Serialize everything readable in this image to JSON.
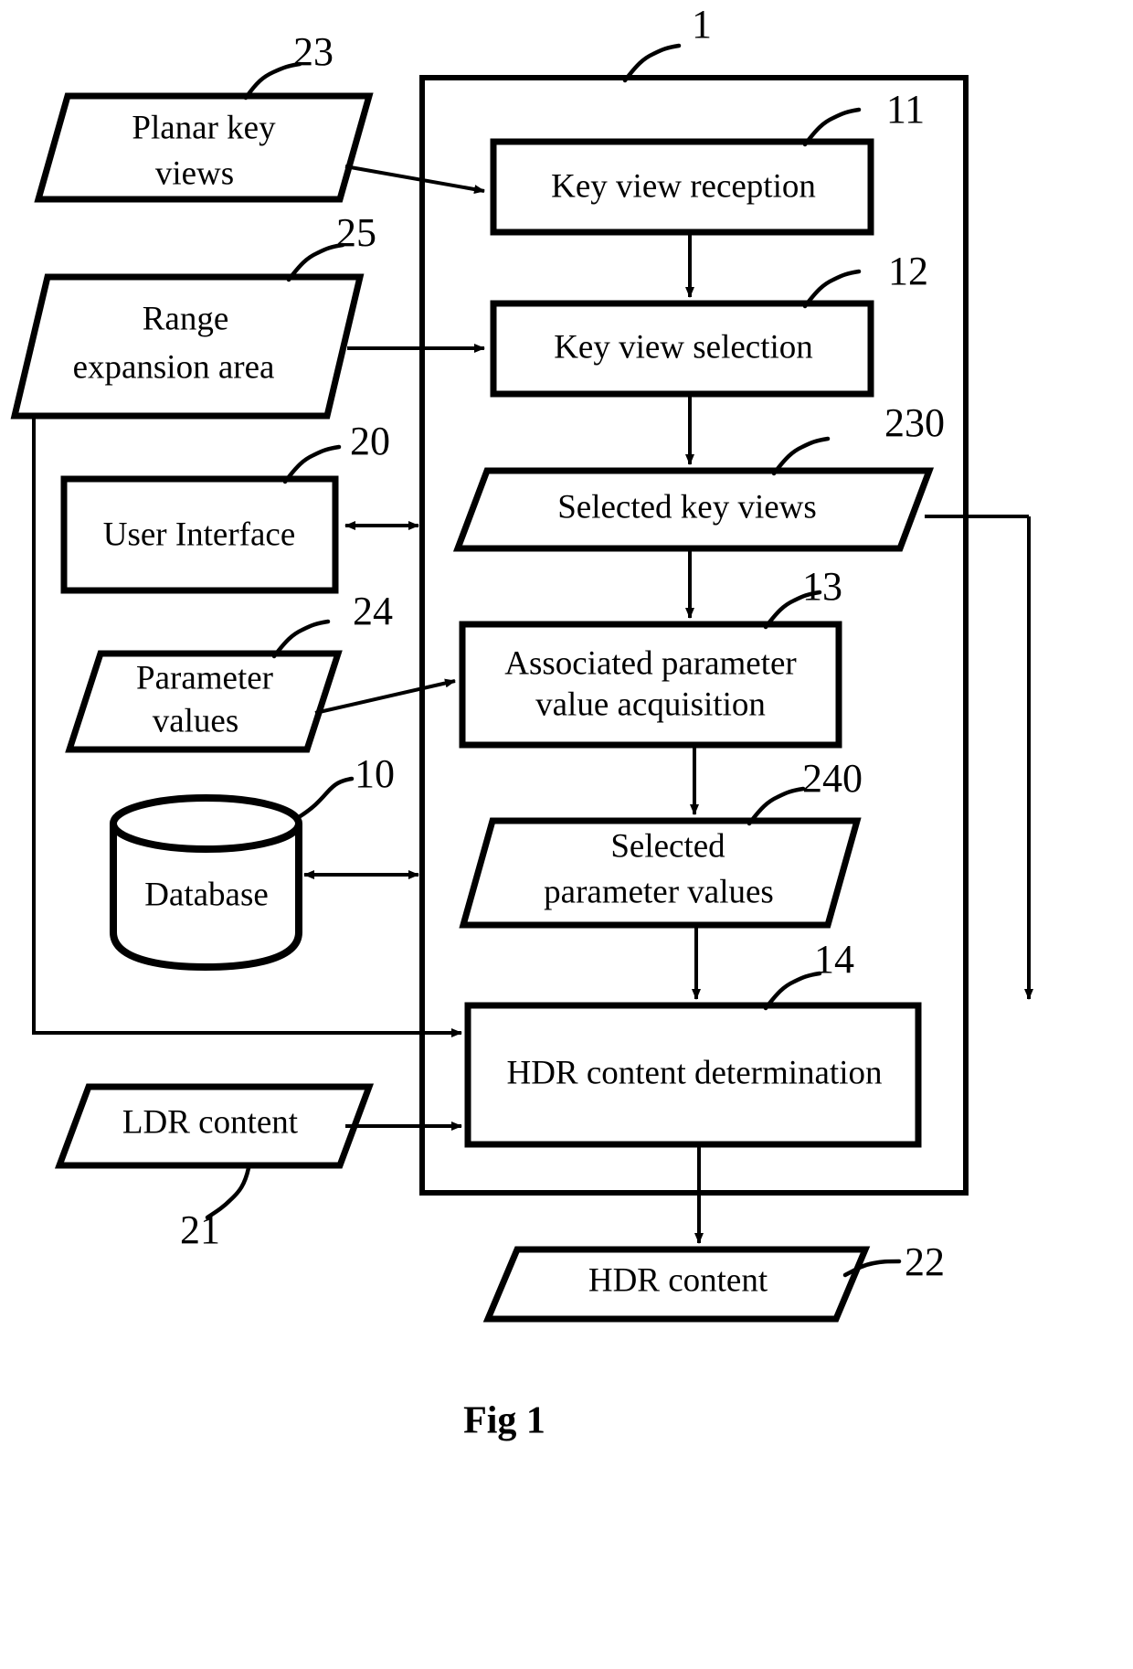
{
  "figure": {
    "caption": "Fig 1",
    "system_ref": "1"
  },
  "nodes": {
    "planar_key_views": {
      "label_line1": "Planar key",
      "label_line2": "views",
      "ref": "23",
      "shape": "parallelogram"
    },
    "range_expansion_area": {
      "label_line1": "Range",
      "label_line2": "expansion area",
      "ref": "25",
      "shape": "parallelogram"
    },
    "user_interface": {
      "label": "User Interface",
      "ref": "20",
      "shape": "rectangle"
    },
    "parameter_values": {
      "label_line1": "Parameter",
      "label_line2": "values",
      "ref": "24",
      "shape": "parallelogram"
    },
    "database": {
      "label": "Database",
      "ref": "10",
      "shape": "cylinder"
    },
    "ldr_content": {
      "label": "LDR content",
      "ref": "21",
      "shape": "parallelogram"
    },
    "key_view_reception": {
      "label": "Key view reception",
      "ref": "11",
      "shape": "rectangle"
    },
    "key_view_selection": {
      "label": "Key view selection",
      "ref": "12",
      "shape": "rectangle"
    },
    "selected_key_views": {
      "label": "Selected key views",
      "ref": "230",
      "shape": "parallelogram"
    },
    "associated_parameter_value_acquisition": {
      "label_line1": "Associated parameter",
      "label_line2": "value acquisition",
      "ref": "13",
      "shape": "rectangle"
    },
    "selected_parameter_values": {
      "label_line1": "Selected",
      "label_line2": "parameter values",
      "ref": "240",
      "shape": "parallelogram"
    },
    "hdr_content_determination": {
      "label": "HDR content determination",
      "ref": "14",
      "shape": "rectangle"
    },
    "hdr_content": {
      "label": "HDR content",
      "ref": "22",
      "shape": "parallelogram"
    }
  },
  "colors": {
    "stroke": "#000000",
    "background": "#ffffff",
    "fill": "#ffffff"
  }
}
